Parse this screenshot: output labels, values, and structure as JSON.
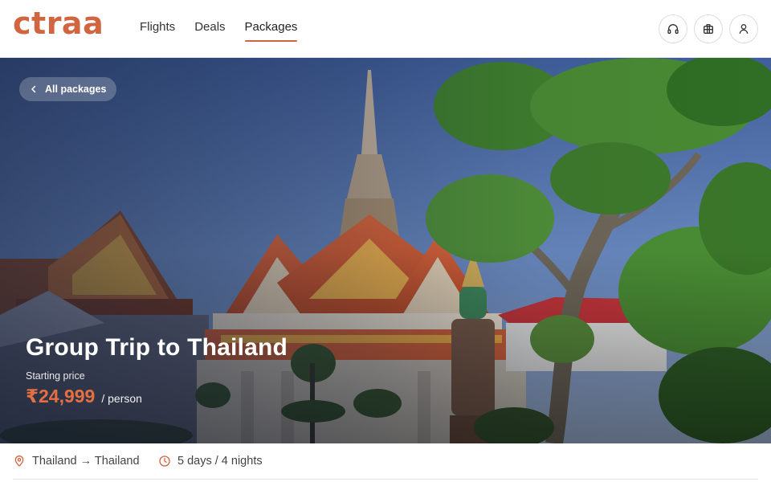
{
  "brand": {
    "logo_text": "ctraa",
    "accent": "#d0653f"
  },
  "nav": {
    "items": [
      {
        "label": "Flights",
        "active": false
      },
      {
        "label": "Deals",
        "active": false
      },
      {
        "label": "Packages",
        "active": true
      }
    ]
  },
  "header_icons": [
    "headset-icon",
    "luggage-icon",
    "user-icon"
  ],
  "hero": {
    "back_label": "All packages",
    "title": "Group Trip to Thailand",
    "starting_label": "Starting price",
    "price": "₹24,999",
    "per_label": "/ person",
    "price_color": "#e66f42"
  },
  "info": {
    "route": "Thailand → Thailand",
    "duration": "5 days / 4 nights",
    "icons": [
      "location-pin-icon",
      "clock-icon"
    ]
  }
}
